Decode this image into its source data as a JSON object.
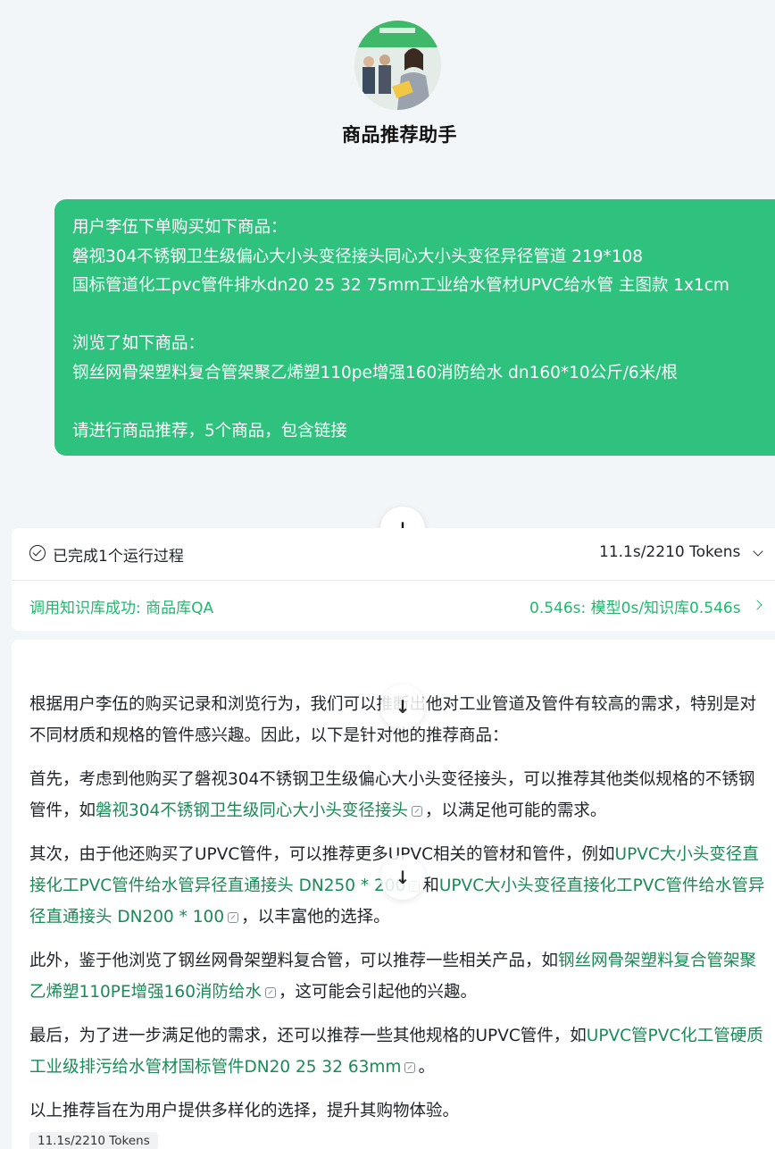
{
  "header": {
    "title": "商品推荐助手",
    "avatar_icon": "assistant-avatar-photo"
  },
  "user_message": {
    "lines": [
      "用户李伍下单购买如下商品：",
      "磐视304不锈钢卫生级偏心大小头变径接头同心大小头变径异径管道 219*108",
      "国标管道化工pvc管件排水dn20 25 32 75mm工业给水管材UPVC给水管 主图款 1x1cm",
      "浏览了如下商品：",
      "钢丝网骨架塑料复合管架聚乙烯塑110pe增强160消防给水 dn160*10公斤/6米/根",
      "请进行商品推荐，5个商品，包含链接"
    ],
    "bubble_color": "#2fc17e"
  },
  "run_panel": {
    "status_label": "已完成1个运行过程",
    "tokens": "11.1s/2210 Tokens",
    "knowledge_call": "调用知识库成功: 商品库QA",
    "knowledge_time": "0.546s: 模型0s/知识库0.546s",
    "accent_color": "#1fb86e"
  },
  "answer": {
    "p1": "根据用户李伍的购买记录和浏览行为，我们可以推断出他对工业管道及管件有较高的需求，特别是对不同材质和规格的管件感兴趣。因此，以下是针对他的推荐商品：",
    "p2_a": "首先，考虑到他购买了磐视304不锈钢卫生级偏心大小头变径接头，可以推荐其他类似规格的不锈钢管件，如",
    "p2_link": "磐视304不锈钢卫生级同心大小头变径接头",
    "p2_b": "，以满足他可能的需求。",
    "p3_a": "其次，由于他还购买了UPVC管件，可以推荐更多UPVC相关的管材和管件，例如",
    "p3_link1": "UPVC大小头变径直接化工PVC管件给水管异径直通接头 DN250 * 200",
    "p3_mid": "和",
    "p3_link2": "UPVC大小头变径直接化工PVC管件给水管异径直通接头 DN200 * 100",
    "p3_b": "，以丰富他的选择。",
    "p4_a": "此外，鉴于他浏览了钢丝网骨架塑料复合管，可以推荐一些相关产品，如",
    "p4_link": "钢丝网骨架塑料复合管架聚乙烯塑110PE增强160消防给水",
    "p4_b": "，这可能会引起他的兴趣。",
    "p5_a": "最后，为了进一步满足他的需求，还可以推荐一些其他规格的UPVC管件，如",
    "p5_link": "UPVC管PVC化工管硬质工业级排污给水管材国标管件DN20 25 32 63mm",
    "p5_b": "。",
    "p6": "以上推荐旨在为用户提供多样化的选择，提升其购物体验。",
    "token_badge": "11.1s/2210 Tokens",
    "link_color": "#1b8a57"
  },
  "scroll_buttons": {
    "icon": "scroll-down-arrow-icon",
    "glyph": "↓"
  }
}
